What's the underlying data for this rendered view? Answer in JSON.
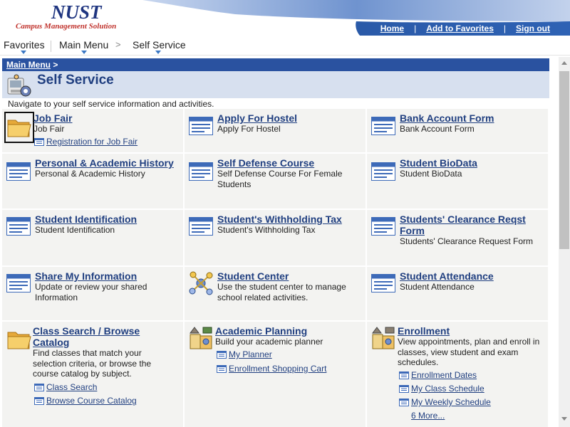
{
  "header": {
    "logo": "NUST",
    "tagline": "Campus Management Solution",
    "links": [
      "Home",
      "Add to Favorites",
      "Sign out"
    ]
  },
  "menubar": {
    "favorites": "Favorites",
    "main_menu": "Main Menu",
    "chevron": ">",
    "self_service": "Self Service"
  },
  "breadcrumb": {
    "link": "Main Menu",
    "sep": ">"
  },
  "page": {
    "title": "Self Service",
    "description": "Navigate to your self service information and activities."
  },
  "tiles": [
    {
      "title": "Job Fair",
      "desc": "Job Fair",
      "links": [
        "Registration for Job Fair"
      ]
    },
    {
      "title": "Apply For Hostel",
      "desc": "Apply For Hostel"
    },
    {
      "title": "Bank Account Form",
      "desc": "Bank Account Form"
    },
    {
      "title": "Personal & Academic History",
      "desc": "Personal & Academic History"
    },
    {
      "title": "Self Defense Course",
      "desc": "Self Defense Course For Female Students"
    },
    {
      "title": "Student BioData",
      "desc": "Student BioData"
    },
    {
      "title": "Student Identification",
      "desc": "Student Identification"
    },
    {
      "title": "Student's Withholding Tax",
      "desc": "Student's Withholding Tax"
    },
    {
      "title": "Students' Clearance Reqst Form",
      "desc": "Students' Clearance Request Form"
    },
    {
      "title": "Share My Information",
      "desc": "Update or review your shared Information"
    },
    {
      "title": "Student Center",
      "desc": "Use the student center to manage school related activities."
    },
    {
      "title": "Student Attendance",
      "desc": "Student Attendance"
    },
    {
      "title": "Class Search / Browse Catalog",
      "desc": "Find classes that match your selection criteria, or browse the course catalog by subject.",
      "links": [
        "Class Search",
        "Browse Course Catalog"
      ]
    },
    {
      "title": "Academic Planning",
      "desc": "Build your academic planner",
      "links": [
        "My Planner",
        "Enrollment Shopping Cart"
      ]
    },
    {
      "title": "Enrollment",
      "desc": "View appointments, plan and enroll in classes, view student and exam schedules.",
      "links": [
        "Enrollment Dates",
        "My Class Schedule",
        "My Weekly Schedule"
      ],
      "more": "6 More..."
    }
  ],
  "colors": {
    "header_blue": "#2f5fb0",
    "breadcrumb_bg": "#2a52a0",
    "title_bg": "#d7e0ef",
    "link": "#203f80",
    "tile_bg": "#f3f3f1"
  }
}
